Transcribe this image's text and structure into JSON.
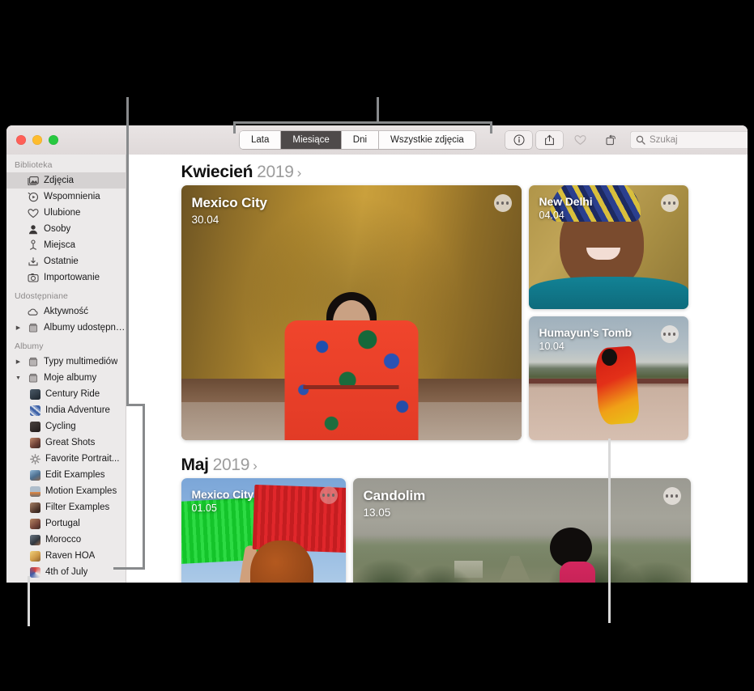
{
  "window": {
    "traffic_lights": [
      "close",
      "minimize",
      "zoom"
    ]
  },
  "toolbar": {
    "segments": [
      {
        "label": "Lata",
        "selected": false
      },
      {
        "label": "Miesiące",
        "selected": true
      },
      {
        "label": "Dni",
        "selected": false
      },
      {
        "label": "Wszystkie zdjęcia",
        "selected": false
      }
    ],
    "buttons": [
      {
        "name": "info-icon",
        "glyph": "ⓘ"
      },
      {
        "name": "share-icon",
        "glyph": "share"
      },
      {
        "name": "favorite-icon",
        "glyph": "heart"
      },
      {
        "name": "rotate-icon",
        "glyph": "rotate"
      }
    ],
    "search": {
      "placeholder": "Szukaj",
      "value": "",
      "icon": "search-icon"
    }
  },
  "sidebar": {
    "groups": [
      {
        "header": "Biblioteka",
        "items": [
          {
            "label": "Zdjęcia",
            "icon": "photos-icon",
            "selected": true
          },
          {
            "label": "Wspomnienia",
            "icon": "memories-icon",
            "selected": false
          },
          {
            "label": "Ulubione",
            "icon": "heart-icon",
            "selected": false
          },
          {
            "label": "Osoby",
            "icon": "person-icon",
            "selected": false
          },
          {
            "label": "Miejsca",
            "icon": "map-pin-icon",
            "selected": false
          },
          {
            "label": "Ostatnie",
            "icon": "download-icon",
            "selected": false
          },
          {
            "label": "Importowanie",
            "icon": "camera-icon",
            "selected": false
          }
        ]
      },
      {
        "header": "Udostępniane",
        "items": [
          {
            "label": "Aktywność",
            "icon": "cloud-icon",
            "selected": false
          },
          {
            "label": "Albumy udostępniane",
            "icon": "album-icon",
            "selected": false,
            "disclosure": "collapsed"
          }
        ]
      },
      {
        "header": "Albumy",
        "items": [
          {
            "label": "Typy multimediów",
            "icon": "album-icon",
            "selected": false,
            "disclosure": "collapsed"
          },
          {
            "label": "Moje albumy",
            "icon": "album-icon",
            "selected": false,
            "disclosure": "expanded"
          }
        ]
      }
    ],
    "albums": [
      {
        "label": "Century Ride",
        "color": "#2b3540"
      },
      {
        "label": "India Adventure",
        "color": "#5f7fb8"
      },
      {
        "label": "Cycling",
        "color": "#352e2c"
      },
      {
        "label": "Great Shots",
        "color": "#8a5b4a"
      },
      {
        "label": "Favorite Portrait...",
        "color": "#e8e6e4",
        "icon": "smart-album-icon"
      },
      {
        "label": "Edit Examples",
        "color": "#5a86ad"
      },
      {
        "label": "Motion Examples",
        "color": "#8a9cb0"
      },
      {
        "label": "Filter Examples",
        "color": "#6b5246"
      },
      {
        "label": "Portugal",
        "color": "#7e4f3d"
      },
      {
        "label": "Morocco",
        "color": "#3f4a57"
      },
      {
        "label": "Raven HOA",
        "color": "#d8a860"
      },
      {
        "label": "4th of July",
        "color": "#b6453c"
      }
    ]
  },
  "content": {
    "sections": [
      {
        "month": "Kwiecień",
        "year": "2019",
        "chevron": "›",
        "photos": [
          {
            "title": "Mexico City",
            "date": "30.04",
            "art": "ph-mexico",
            "size": "large"
          },
          {
            "title": "New Delhi",
            "date": "04.04",
            "art": "ph-delhi",
            "size": "small"
          },
          {
            "title": "Humayun's Tomb",
            "date": "10.04",
            "art": "ph-tomb",
            "size": "small"
          }
        ]
      },
      {
        "month": "Maj",
        "year": "2019",
        "chevron": "›",
        "photos": [
          {
            "title": "Mexico City",
            "date": "01.05",
            "art": "ph-mex2",
            "size": "medium"
          },
          {
            "title": "Candolim",
            "date": "13.05",
            "art": "ph-cando",
            "size": "large"
          }
        ]
      }
    ]
  },
  "callouts": {
    "line_color": "#888a8c",
    "light_line_color": "#d9d9d9",
    "targets": [
      "sidebar",
      "view-segmented-control",
      "album-list",
      "photo-card-grid"
    ]
  }
}
